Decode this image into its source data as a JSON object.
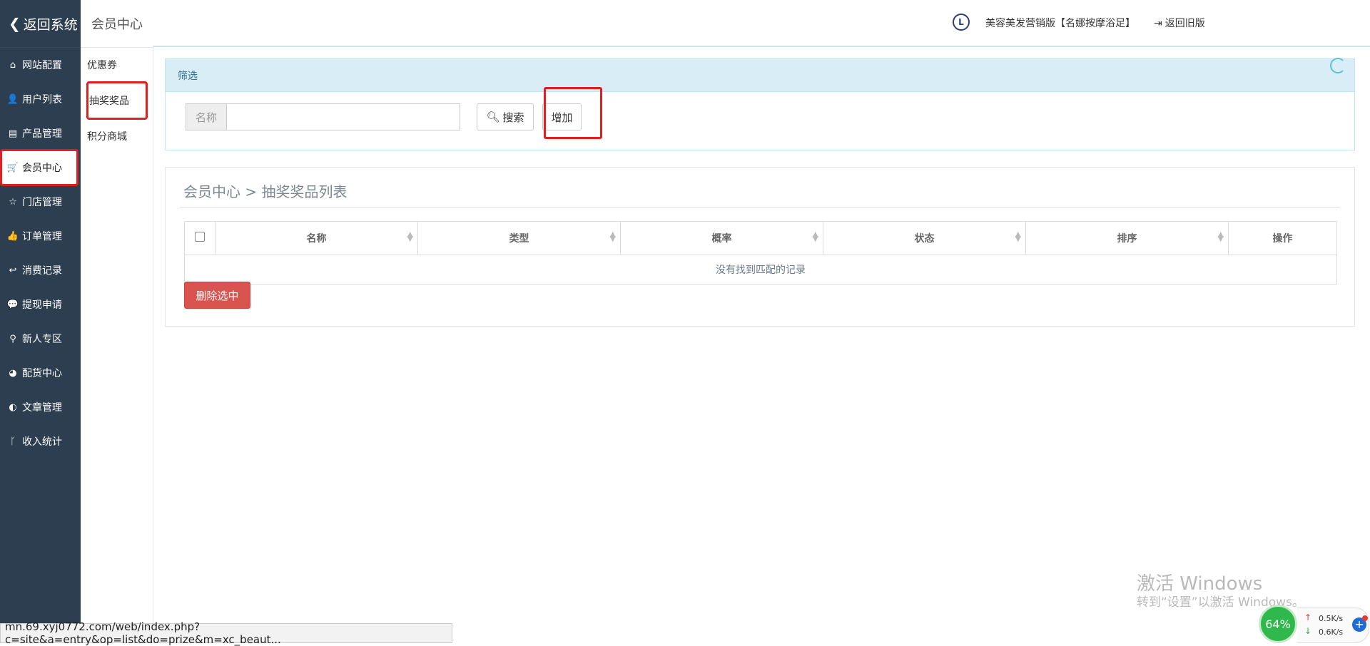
{
  "sidebar": {
    "back_label": "返回系统",
    "items": [
      {
        "label": "网站配置",
        "icon": "home-icon",
        "glyph": "⌂"
      },
      {
        "label": "用户列表",
        "icon": "user-icon",
        "glyph": "👤"
      },
      {
        "label": "产品管理",
        "icon": "server-icon",
        "glyph": "▤"
      },
      {
        "label": "会员中心",
        "icon": "cart-icon",
        "glyph": "🛒"
      },
      {
        "label": "门店管理",
        "icon": "star-icon",
        "glyph": "☆"
      },
      {
        "label": "订单管理",
        "icon": "thumbs-up-icon",
        "glyph": "👍"
      },
      {
        "label": "消费记录",
        "icon": "reply-icon",
        "glyph": "↩"
      },
      {
        "label": "提现申请",
        "icon": "wechat-icon",
        "glyph": "💬"
      },
      {
        "label": "新人专区",
        "icon": "map-pin-icon",
        "glyph": "⚲"
      },
      {
        "label": "配货中心",
        "icon": "pie-chart-icon",
        "glyph": "◕"
      },
      {
        "label": "文章管理",
        "icon": "adjust-icon",
        "glyph": "◐"
      },
      {
        "label": "收入统计",
        "icon": "branch-icon",
        "glyph": "ᚴ"
      }
    ]
  },
  "subnav": {
    "title": "会员中心",
    "items": [
      "优惠券",
      "抽奖奖品",
      "积分商城"
    ]
  },
  "header": {
    "clock_glyph": "L",
    "shop_name": "美容美发营销版【名娜按摩浴足】",
    "return_old_label": "返回旧版"
  },
  "filter": {
    "title": "筛选",
    "name_label": "名称",
    "name_value": "",
    "search_label": "搜索",
    "add_label": "增加"
  },
  "list": {
    "title": "会员中心 > 抽奖奖品列表",
    "columns": [
      "名称",
      "类型",
      "概率",
      "状态",
      "排序",
      "操作"
    ],
    "empty_text": "没有找到匹配的记录",
    "delete_label": "删除选中"
  },
  "watermark": {
    "line1": "激活 Windows",
    "line2": "转到“设置”以激活 Windows。"
  },
  "statusbar": {
    "url": "mn.69.xyj0772.com/web/index.php?c=site&a=entry&op=list&do=prize&m=xc_beaut..."
  },
  "netwidget": {
    "percent": "64%",
    "up": "0.5K/s",
    "down": "0.6K/s"
  },
  "colors": {
    "sidebar_bg": "#2c3e50",
    "highlight_red": "#e0201e",
    "danger": "#d9534f",
    "info_bg": "#d9edf7"
  }
}
